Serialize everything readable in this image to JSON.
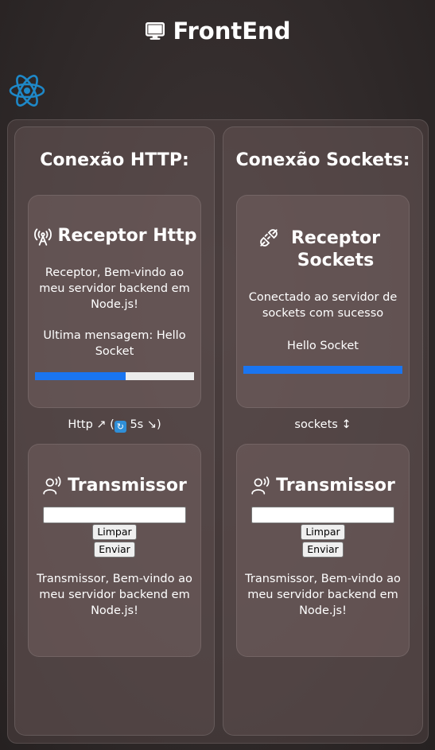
{
  "app": {
    "title": "FrontEnd"
  },
  "http": {
    "title": "Conexão HTTP:",
    "receiver": {
      "title": "Receptor Http",
      "message": "Receptor, Bem-vindo ao meu servidor backend em Node.js!",
      "last_message": "Ultima mensagem: Hello Socket",
      "progress": 0.57
    },
    "link_prefix": "Http ↗ (",
    "link_interval": "5s ↘)",
    "transmitter": {
      "title": "Transmissor",
      "input_value": "",
      "clear_label": "Limpar",
      "send_label": "Enviar",
      "message": "Transmissor, Bem-vindo ao meu servidor backend em Node.js!"
    }
  },
  "sockets": {
    "title": "Conexão Sockets:",
    "receiver": {
      "title": "Receptor Sockets",
      "message": "Conectado ao servidor de sockets com sucesso",
      "last_message": "Hello Socket",
      "progress": 1.0
    },
    "link": "sockets ↕",
    "transmitter": {
      "title": "Transmissor",
      "input_value": "",
      "clear_label": "Limpar",
      "send_label": "Enviar",
      "message": "Transmissor, Bem-vindo ao meu servidor backend em Node.js!"
    }
  },
  "colors": {
    "progress_fill": "#1a75f0",
    "progress_track": "#ececec",
    "react_logo": "#1e88c8"
  },
  "icons": [
    "monitor-icon",
    "react-logo-icon",
    "antenna-icon",
    "plug-icon",
    "speaking-user-icon"
  ]
}
